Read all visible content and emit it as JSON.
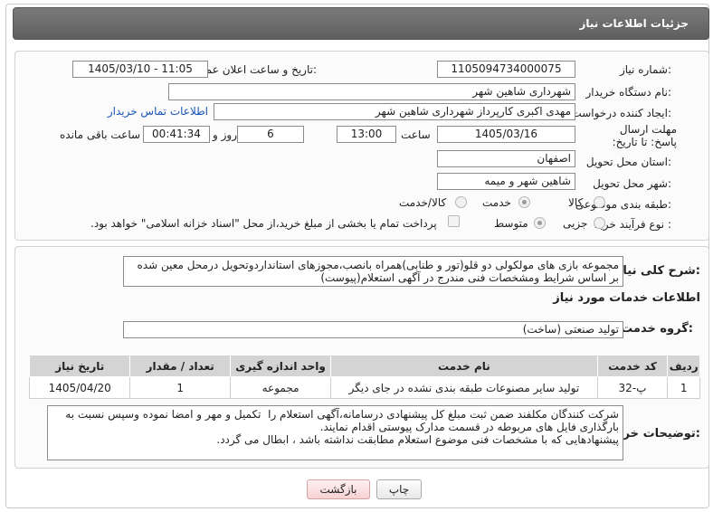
{
  "header": {
    "title": "جزئیات اطلاعات نیاز"
  },
  "form": {
    "need_number": {
      "label": "شماره نیاز:",
      "value": "1105094734000075"
    },
    "announce_datetime": {
      "label": "تاریخ و ساعت اعلان عمومی:",
      "value": "1405/03/10 - 11:05"
    },
    "buyer_org": {
      "label": "نام دستگاه خریدار:",
      "value": "شهرداری شاهین شهر"
    },
    "requester": {
      "label": "ایجاد کننده درخواست:",
      "value": "مهدی اکبری کارپرداز شهرداری شاهین شهر",
      "contact_link": "اطلاعات تماس خریدار"
    },
    "deadline": {
      "label": "مهلت ارسال پاسخ: تا تاریخ:",
      "date": "1405/03/16",
      "time_label": "ساعت",
      "time": "13:00",
      "days": "6",
      "days_label": "روز و",
      "remaining": "00:41:34",
      "remaining_label": "ساعت باقی مانده"
    },
    "province": {
      "label": "استان محل تحویل:",
      "value": "اصفهان"
    },
    "city": {
      "label": "شهر محل تحویل:",
      "value": "شاهین شهر و میمه"
    },
    "category": {
      "label": "طبقه بندی موضوعی:",
      "options": [
        "کالا",
        "خدمت",
        "کالا/خدمت"
      ],
      "selected": "خدمت"
    },
    "purchase_type": {
      "label": "نوع فرآیند خرید :",
      "options": [
        "جزیی",
        "متوسط"
      ],
      "selected": "متوسط",
      "note": "پرداخت تمام یا بخشی از مبلغ خرید،از محل \"اسناد خزانه اسلامی\" خواهد بود."
    }
  },
  "description": {
    "label": "شرح کلی نیاز:",
    "text": "مجموعه بازی های مولکولی دو قلو(تور و طنابی)همراه بانصب،مجوزهای استانداردوتحویل درمحل معین شده بر اساس شرایط ومشخصات فنی مندرج در آگهی استعلام(پیوست)"
  },
  "services": {
    "section_title": "اطلاعات خدمات مورد نیاز",
    "group_label": "گروه خدمت:",
    "group_value": "تولید صنعتی (ساخت)",
    "columns": [
      "ردیف",
      "کد خدمت",
      "نام خدمت",
      "واحد اندازه گیری",
      "تعداد / مقدار",
      "تاریخ نیاز"
    ],
    "rows": [
      [
        "1",
        "پ-32",
        "تولید سایر مصنوعات طبقه بندی نشده در جای دیگر",
        "مجموعه",
        "1",
        "1405/04/20"
      ]
    ]
  },
  "buyer_notes": {
    "label": "توضیحات خریدار:",
    "text": "شرکت کنندگان مکلفند ضمن ثبت مبلغ کل پیشنهادی درسامانه،آگهی استعلام را  تکمیل و مهر و امضا نموده وسپس نسبت به بارگذاری فایل های مربوطه در قسمت مدارک پیوستی اقدام نمایند.\nپیشنهادهایی که با مشخصات فنی موضوع استعلام مطابقت نداشته باشد ، ابطال می گردد."
  },
  "buttons": {
    "print": "چاپ",
    "back": "بازگشت"
  },
  "colors": {
    "header": "#6b6b6b",
    "link": "#1a55b8",
    "watermark": "#c21b1b"
  }
}
